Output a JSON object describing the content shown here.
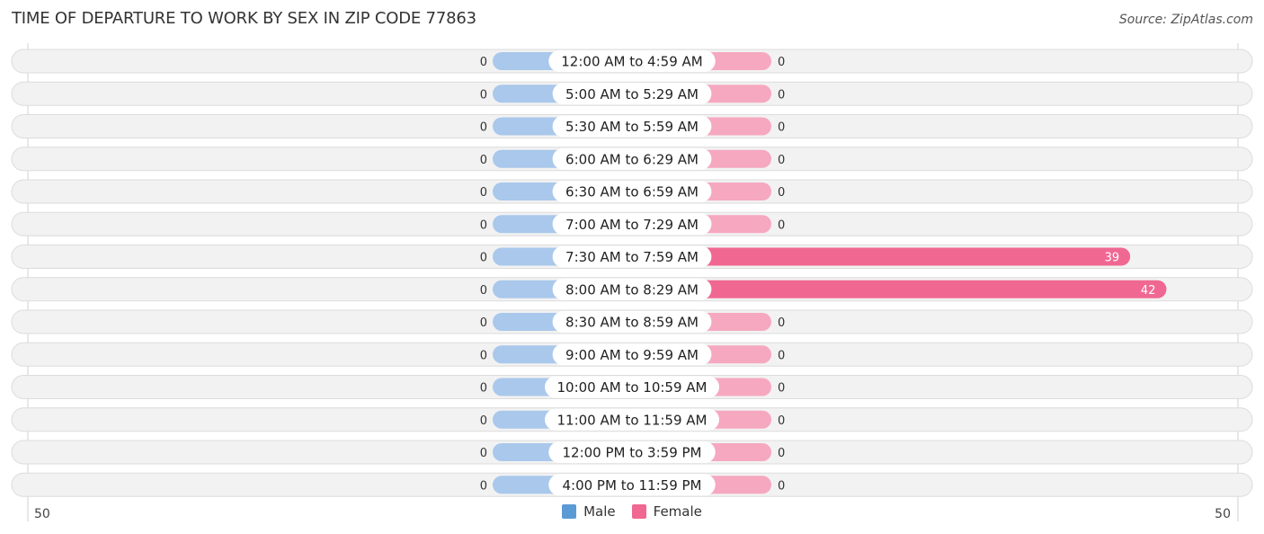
{
  "header": {
    "title": "TIME OF DEPARTURE TO WORK BY SEX IN ZIP CODE 77863",
    "source": "Source: ZipAtlas.com"
  },
  "legend": {
    "male_label": "Male",
    "female_label": "Female"
  },
  "colors": {
    "male": "#5b9bd5",
    "male_light": "#a9c8eb",
    "female": "#f06892",
    "female_light": "#f6a8c0",
    "row_bg": "#f2f2f2"
  },
  "chart_data": {
    "type": "bar",
    "orientation": "horizontal-diverging",
    "title": "TIME OF DEPARTURE TO WORK BY SEX IN ZIP CODE 77863",
    "categories": [
      "12:00 AM to 4:59 AM",
      "5:00 AM to 5:29 AM",
      "5:30 AM to 5:59 AM",
      "6:00 AM to 6:29 AM",
      "6:30 AM to 6:59 AM",
      "7:00 AM to 7:29 AM",
      "7:30 AM to 7:59 AM",
      "8:00 AM to 8:29 AM",
      "8:30 AM to 8:59 AM",
      "9:00 AM to 9:59 AM",
      "10:00 AM to 10:59 AM",
      "11:00 AM to 11:59 AM",
      "12:00 PM to 3:59 PM",
      "4:00 PM to 11:59 PM"
    ],
    "series": [
      {
        "name": "Male",
        "values": [
          0,
          0,
          0,
          0,
          0,
          0,
          0,
          0,
          0,
          0,
          0,
          0,
          0,
          0
        ]
      },
      {
        "name": "Female",
        "values": [
          0,
          0,
          0,
          0,
          0,
          0,
          39,
          42,
          0,
          0,
          0,
          0,
          0,
          0
        ]
      }
    ],
    "axis": {
      "left_tick": "50",
      "right_tick": "50",
      "range": [
        50,
        50
      ]
    },
    "legend_position": "bottom-center",
    "grid": false
  }
}
